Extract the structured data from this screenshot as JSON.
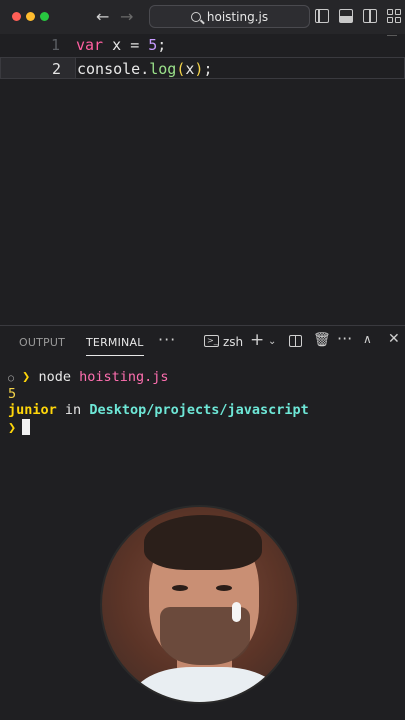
{
  "window": {
    "title": "hoisting.js"
  },
  "editor": {
    "lines": [
      {
        "number": "1",
        "tokens": {
          "kw": "var",
          "id": "x",
          "op": "=",
          "num": "5",
          "semi": ";"
        }
      },
      {
        "number": "2",
        "tokens": {
          "obj": "console",
          "dot": ".",
          "fn": "log",
          "open": "(",
          "arg": "x",
          "close": ")",
          "semi": ";"
        }
      }
    ]
  },
  "panel": {
    "tabs": {
      "output": "OUTPUT",
      "terminal": "TERMINAL"
    },
    "shell_name": "zsh",
    "terminal": {
      "prompt_symbol": "❯",
      "command": "node",
      "argument": "hoisting.js",
      "output": "5",
      "user": "junior",
      "in_word": "in",
      "path": "Desktop/projects/javascript"
    }
  },
  "icons": [
    "back-arrow-icon",
    "forward-arrow-icon",
    "search-icon",
    "layout-sidebar-icon",
    "layout-panel-icon",
    "layout-split-icon",
    "layout-grid-icon",
    "terminal-icon",
    "plus-icon",
    "chevron-down-icon",
    "split-terminal-icon",
    "trash-icon",
    "more-icon",
    "maximize-panel-icon",
    "close-icon"
  ],
  "colors": {
    "keyword": "#ff5fa0",
    "number": "#c79bff",
    "function": "#9be28b",
    "paren": "#f3d34a",
    "prompt": "#ffd60a",
    "path": "#6ee7d7",
    "background": "#1f1f22"
  }
}
